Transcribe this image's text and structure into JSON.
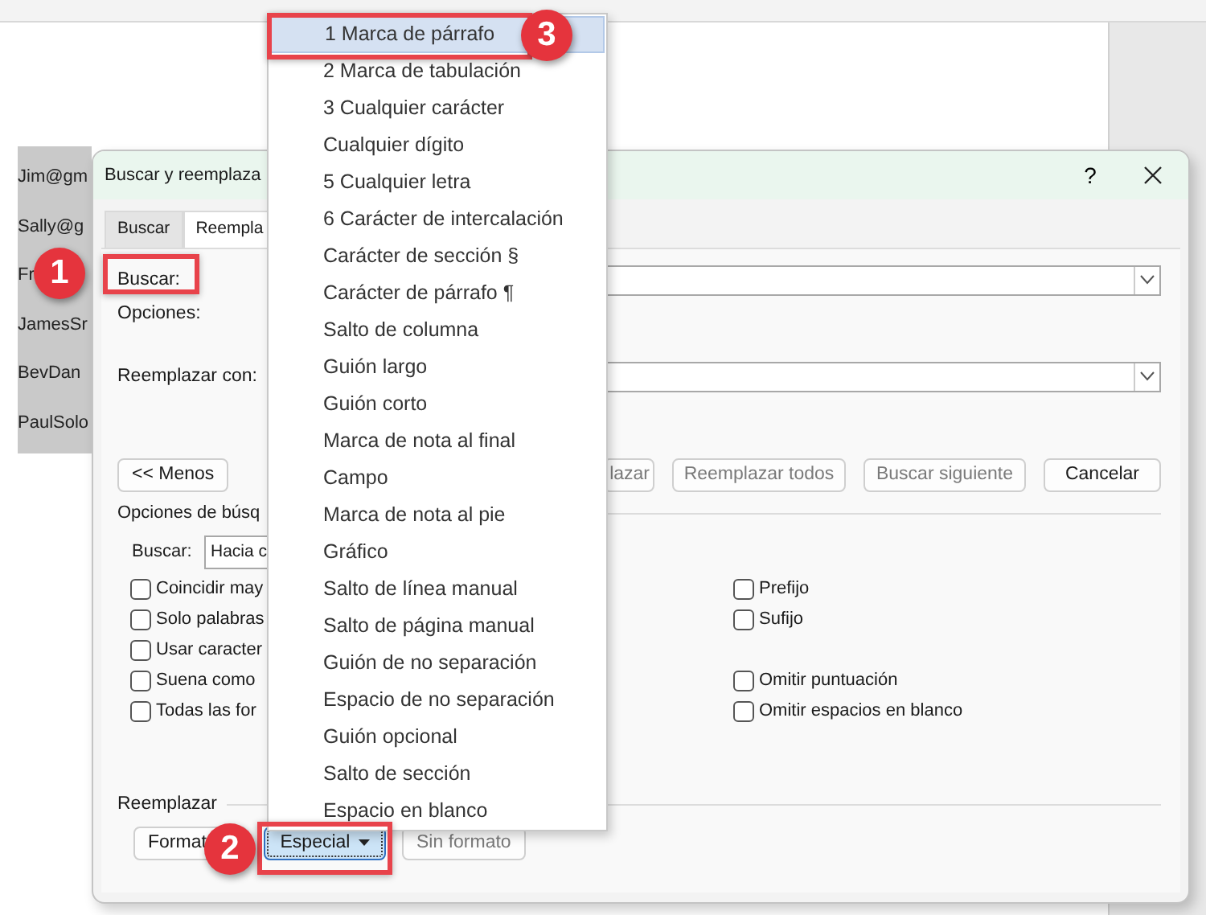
{
  "document": {
    "cells": [
      "Jim@gm",
      "Sally@g",
      "Fr",
      "JamesSr",
      "BevDan",
      "PaulSolo"
    ]
  },
  "dialog": {
    "title": "Buscar y reemplaza",
    "help": "?",
    "tabs": [
      {
        "label": "Buscar",
        "selected": false
      },
      {
        "label": "Reempla",
        "selected": true
      }
    ],
    "find_label": "Buscar:",
    "options_label": "Opciones:",
    "replace_label": "Reemplazar con:",
    "left_buttons": [
      {
        "label": "<< Menos",
        "disabled": false
      }
    ],
    "right_buttons": [
      {
        "label": "lazar",
        "disabled": true
      },
      {
        "label": "Reemplazar todos",
        "disabled": true
      },
      {
        "label": "Buscar siguiente",
        "disabled": true
      },
      {
        "label": "Cancelar",
        "disabled": false
      }
    ],
    "search_options": {
      "title": "Opciones de búsq",
      "direction_label": "Buscar:",
      "direction_value": "Hacia c",
      "left_checks": [
        {
          "label": "Coincidir may",
          "checked": false
        },
        {
          "label": "Solo palabras",
          "checked": false
        },
        {
          "label": "Usar caracter",
          "checked": false
        },
        {
          "label": "Suena como",
          "checked": false
        },
        {
          "label": "Todas las for",
          "checked": false
        }
      ],
      "right_check_groups": [
        {
          "checks": [
            {
              "label": "Prefijo",
              "checked": false
            },
            {
              "label": "Sufijo",
              "checked": false
            }
          ]
        },
        {
          "checks": [
            {
              "label": "Omitir puntuación",
              "checked": false
            },
            {
              "label": "Omitir espacios en blanco",
              "checked": false
            }
          ]
        }
      ]
    },
    "replace_section": {
      "title": "Reemplazar",
      "buttons": [
        {
          "label": "Format",
          "kind": "plain",
          "pressed": false,
          "disabled": false
        },
        {
          "label": "Especial",
          "kind": "dropdown",
          "pressed": true,
          "disabled": false
        },
        {
          "label": "Sin formato",
          "kind": "plain",
          "pressed": false,
          "disabled": true
        }
      ]
    }
  },
  "menu": {
    "items": [
      {
        "label": "1 Marca de párrafo",
        "selected": true
      },
      {
        "label": "2 Marca de tabulación",
        "selected": false
      },
      {
        "label": "3 Cualquier carácter",
        "selected": false
      },
      {
        "label": "Cualquier dígito",
        "selected": false
      },
      {
        "label": "5 Cualquier letra",
        "selected": false
      },
      {
        "label": "6 Carácter de intercalación",
        "selected": false
      },
      {
        "label": "Carácter de sección §",
        "selected": false
      },
      {
        "label": "Carácter de párrafo ¶",
        "selected": false
      },
      {
        "label": "Salto de columna",
        "selected": false
      },
      {
        "label": "Guión largo",
        "selected": false
      },
      {
        "label": "Guión corto",
        "selected": false
      },
      {
        "label": "Marca de nota al final",
        "selected": false
      },
      {
        "label": "Campo",
        "selected": false
      },
      {
        "label": "Marca de nota al pie",
        "selected": false
      },
      {
        "label": "Gráfico",
        "selected": false
      },
      {
        "label": "Salto de línea manual",
        "selected": false
      },
      {
        "label": "Salto de página manual",
        "selected": false
      },
      {
        "label": "Guión de no separación",
        "selected": false
      },
      {
        "label": "Espacio de no separación",
        "selected": false
      },
      {
        "label": "Guión opcional",
        "selected": false
      },
      {
        "label": "Salto de sección",
        "selected": false
      },
      {
        "label": "Espacio en blanco",
        "selected": false
      }
    ]
  },
  "callouts": [
    {
      "number": "1"
    },
    {
      "number": "2"
    },
    {
      "number": "3"
    }
  ]
}
